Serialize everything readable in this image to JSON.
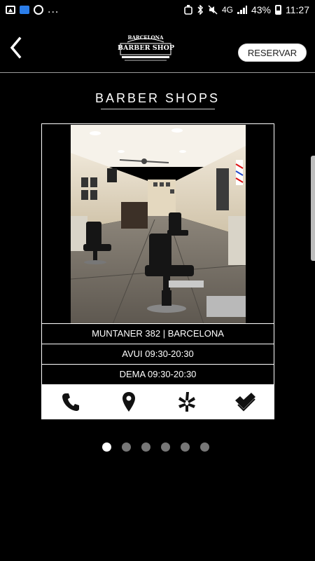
{
  "statusbar": {
    "more": "...",
    "network": "4G",
    "battery": "43%",
    "time": "11:27"
  },
  "header": {
    "logo_top": "BARCELONA",
    "logo_main": "BARBER SHOP",
    "reserve_label": "RESERVAR"
  },
  "page": {
    "title": "BARBER SHOPS"
  },
  "shop": {
    "address": "MUNTANER 382 | BARCELONA",
    "today_hours": "AVUI 09:30-20:30",
    "tomorrow_hours": "DEMA 09:30-20:30"
  },
  "actions": [
    {
      "icon": "phone-icon"
    },
    {
      "icon": "map-pin-icon"
    },
    {
      "icon": "yelp-icon"
    },
    {
      "icon": "foursquare-icon"
    }
  ],
  "pagination": {
    "total": 6,
    "active": 0
  },
  "colors": {
    "background": "#000000",
    "text": "#ffffff",
    "button_bg": "#ffffff",
    "dot_inactive": "#777777"
  }
}
